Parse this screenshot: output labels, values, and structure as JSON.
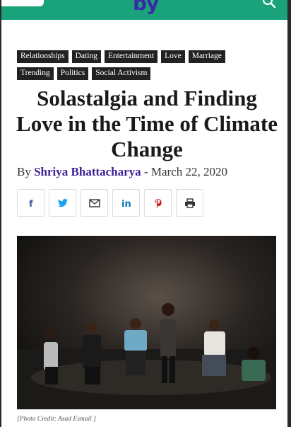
{
  "header": {
    "logo_text": "by",
    "colors": {
      "bar": "#1aa37a",
      "logo": "#3a2aa8"
    }
  },
  "tags": [
    [
      "Relationships",
      "Dating",
      "Entertainment",
      "Love",
      "Marriage"
    ],
    [
      "Trending",
      "Politics",
      "Social Activism"
    ]
  ],
  "article": {
    "title": "Solastalgia and Finding Love in the Time of Climate Change",
    "byline_prefix": "By",
    "author": "Shriya Bhattacharya",
    "separator": "-",
    "date": "March 22, 2020"
  },
  "share": [
    {
      "name": "facebook",
      "glyph": "f",
      "color": "#3b5998"
    },
    {
      "name": "twitter",
      "glyph": "twitter",
      "color": "#1da1f2"
    },
    {
      "name": "email",
      "glyph": "email",
      "color": "#333333"
    },
    {
      "name": "linkedin",
      "glyph": "in",
      "color": "#0077b5"
    },
    {
      "name": "pinterest",
      "glyph": "pinterest",
      "color": "#cb2027"
    },
    {
      "name": "print",
      "glyph": "print",
      "color": "#333333"
    }
  ],
  "photo": {
    "credit": "[Photo Credit: Asad Esmail ]"
  }
}
